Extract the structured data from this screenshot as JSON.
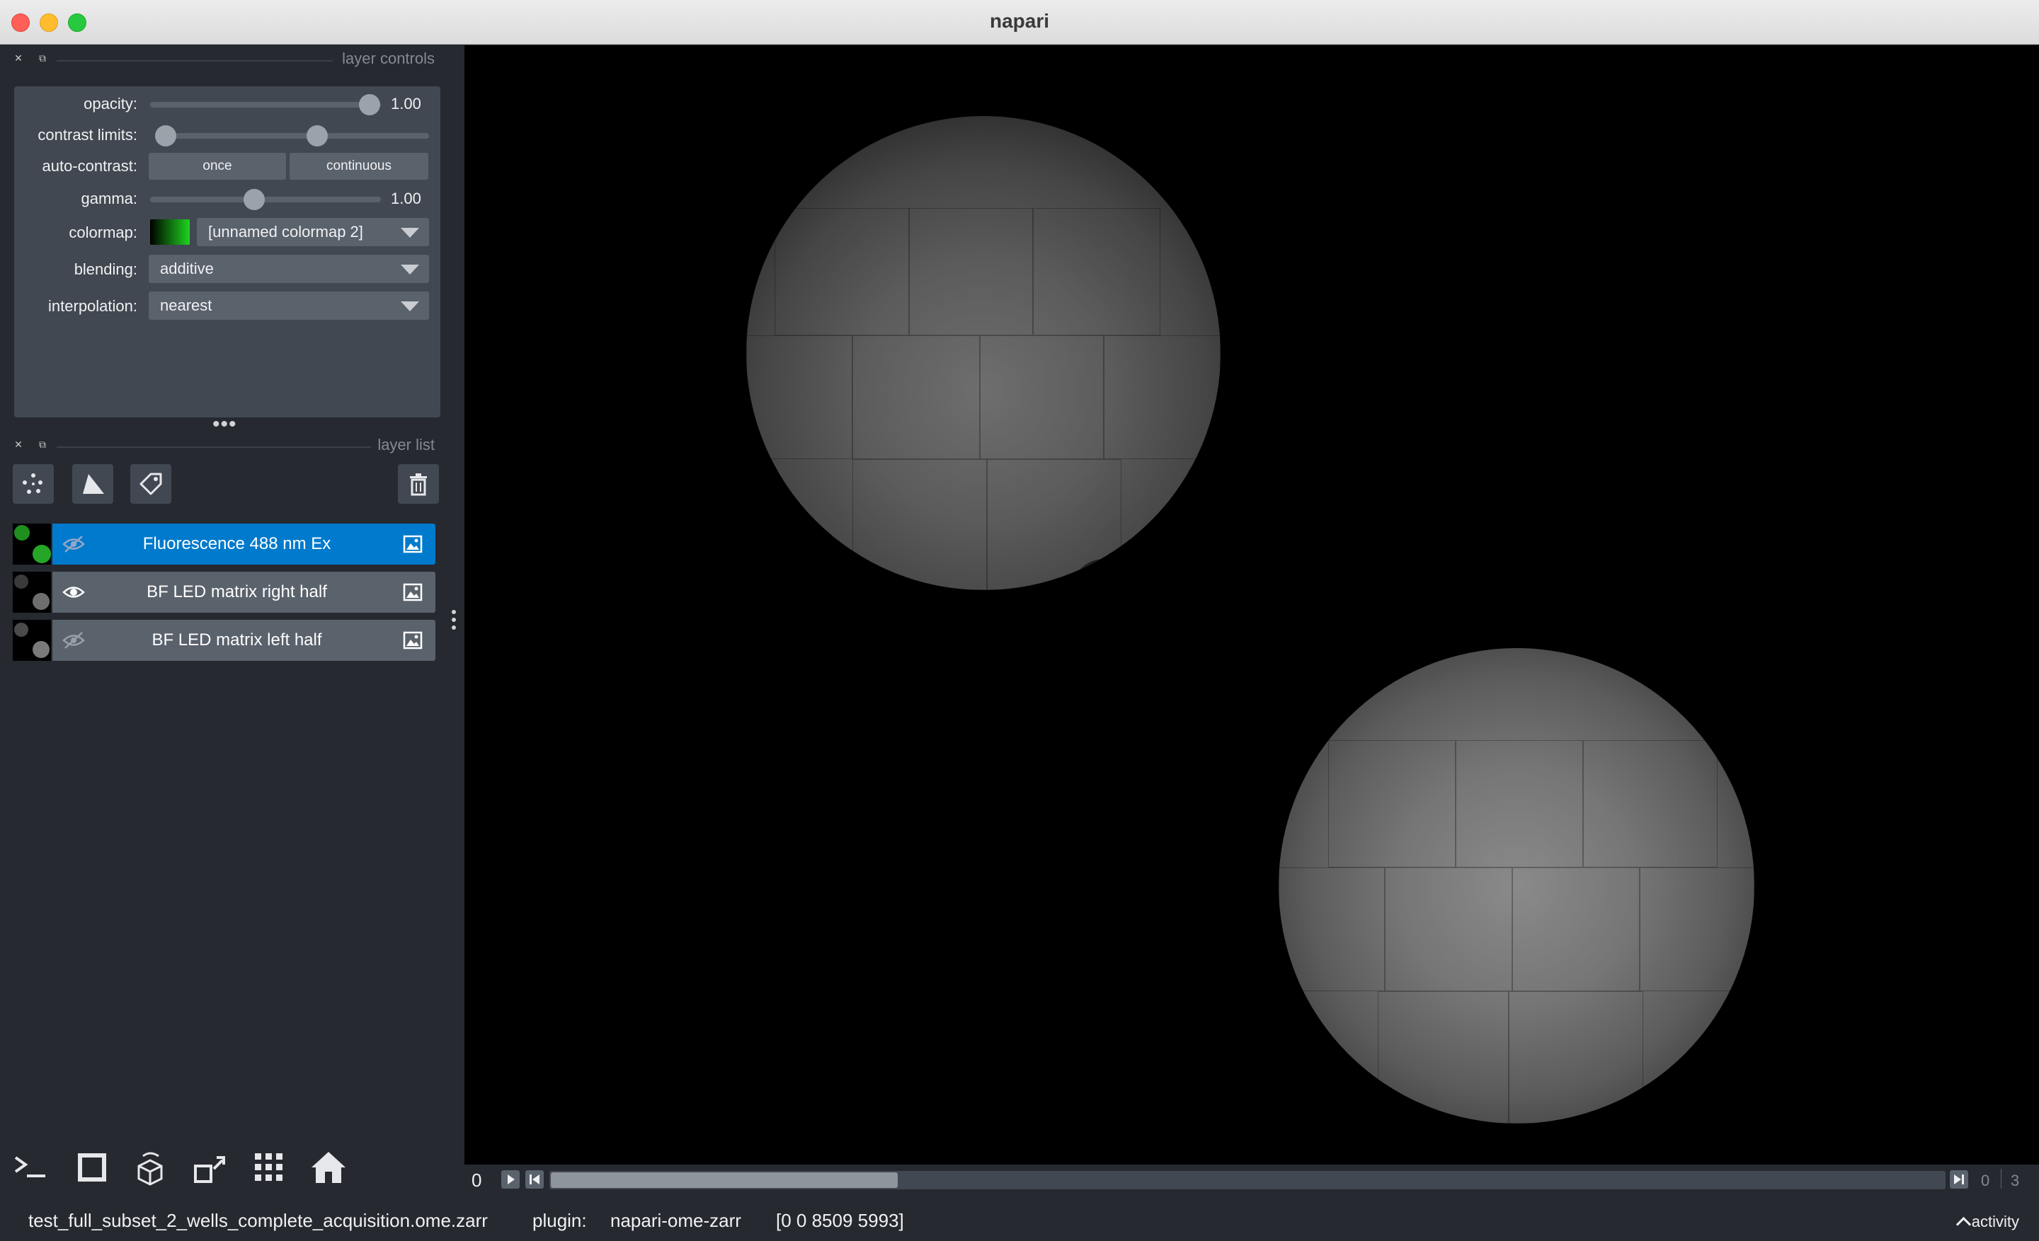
{
  "window": {
    "title": "napari"
  },
  "layer_controls": {
    "title": "layer controls",
    "opacity": {
      "label": "opacity:",
      "value": "1.00",
      "level": 1.0
    },
    "contrast_limits": {
      "label": "contrast limits:",
      "low": 0.0,
      "high": 0.6
    },
    "auto_contrast": {
      "label": "auto-contrast:",
      "once_label": "once",
      "continuous_label": "continuous"
    },
    "gamma": {
      "label": "gamma:",
      "value": "1.00",
      "level": 0.45
    },
    "colormap": {
      "label": "colormap:",
      "value": "[unnamed colormap 2]",
      "swatch_start": "#000000",
      "swatch_end": "#1fd41f"
    },
    "blending": {
      "label": "blending:",
      "value": "additive"
    },
    "interpolation": {
      "label": "interpolation:",
      "value": "nearest"
    }
  },
  "layer_list": {
    "title": "layer list",
    "tools": [
      "new-points",
      "new-shapes",
      "new-labels"
    ],
    "delete": "delete-layer",
    "layers": [
      {
        "name": "Fluorescence 488 nm Ex",
        "visible": false,
        "selected": true,
        "type": "image"
      },
      {
        "name": "BF LED matrix right half",
        "visible": true,
        "selected": false,
        "type": "image"
      },
      {
        "name": "BF LED matrix left half",
        "visible": false,
        "selected": false,
        "type": "image"
      }
    ]
  },
  "viewer_buttons": [
    "console",
    "ndisplay-2d",
    "roll-dims",
    "transpose-dims",
    "grid-view",
    "home"
  ],
  "dims": {
    "current": "0",
    "frame": "0",
    "total": "3",
    "position": 0.0
  },
  "status": {
    "file": "test_full_subset_2_wells_complete_acquisition.ome.zarr",
    "plugin_label": "plugin:",
    "plugin": "napari-ome-zarr",
    "coords": "[0 0 8509 5993]",
    "activity": "activity"
  },
  "colors": {
    "accent": "#007acc",
    "panel": "#262930",
    "control": "#414851",
    "widget": "#5a626c"
  }
}
